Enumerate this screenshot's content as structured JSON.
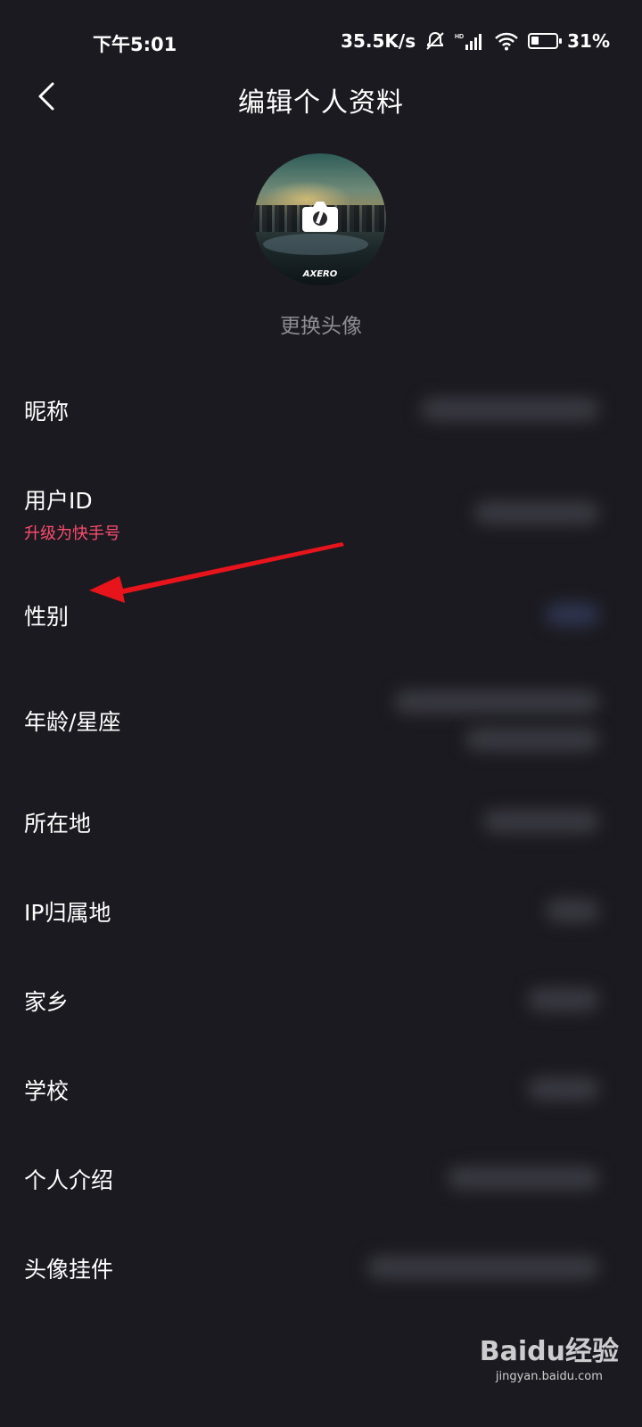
{
  "status_bar": {
    "time": "下午5:01",
    "net_speed": "35.5K/s",
    "battery": "31%",
    "battery_level": 0.31
  },
  "header": {
    "title": "编辑个人资料",
    "back_icon": "chevron-left-icon"
  },
  "avatar": {
    "overlay_icon": "camera-icon",
    "watermark_text": "AXERO",
    "change_label": "更换头像"
  },
  "fields": [
    {
      "label": "昵称"
    },
    {
      "label": "用户ID",
      "sublabel": "升级为快手号",
      "sublabel_color": "#fe4c6e"
    },
    {
      "label": "性别"
    },
    {
      "label": "年龄/星座"
    },
    {
      "label": "所在地"
    },
    {
      "label": "IP归属地"
    },
    {
      "label": "家乡"
    },
    {
      "label": "学校"
    },
    {
      "label": "个人介绍"
    },
    {
      "label": "头像挂件"
    }
  ],
  "annotation": {
    "arrow_color": "#e8141b",
    "arrow_target": "性别"
  },
  "watermark": {
    "logo": "Baidu经验",
    "url": "jingyan.baidu.com"
  }
}
